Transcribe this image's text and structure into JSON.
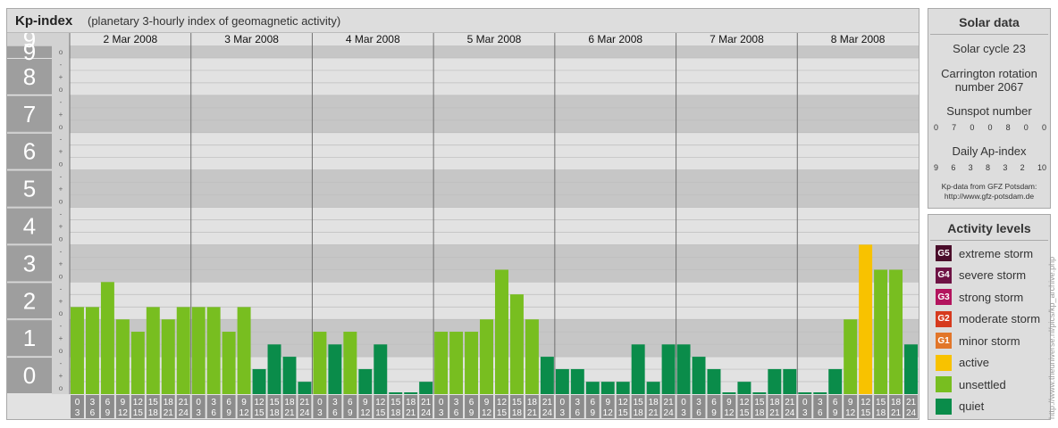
{
  "header": {
    "title": "Kp-index",
    "subtitle": "(planetary 3-hourly index of geomagnetic activity)"
  },
  "chart_data": {
    "type": "bar",
    "days": [
      "2 Mar 2008",
      "3 Mar 2008",
      "4 Mar 2008",
      "5 Mar 2008",
      "6 Mar 2008",
      "7 Mar 2008",
      "8 Mar 2008"
    ],
    "hour_ranges": [
      [
        "0",
        "3"
      ],
      [
        "3",
        "6"
      ],
      [
        "6",
        "9"
      ],
      [
        "9",
        "12"
      ],
      [
        "12",
        "15"
      ],
      [
        "15",
        "18"
      ],
      [
        "18",
        "21"
      ],
      [
        "21",
        "24"
      ]
    ],
    "y_major_ticks": [
      "0",
      "1",
      "2",
      "3",
      "4",
      "5",
      "6",
      "7",
      "8",
      "9"
    ],
    "y_minor_ticks": [
      "o",
      "+",
      "-"
    ],
    "ylim": [
      0,
      9.33
    ],
    "values": [
      [
        2.33,
        2.33,
        3.0,
        2.0,
        1.67,
        2.33,
        2.0,
        2.33
      ],
      [
        2.33,
        2.33,
        1.67,
        2.33,
        0.67,
        1.33,
        1.0,
        0.33
      ],
      [
        1.67,
        1.33,
        1.67,
        0.67,
        1.33,
        0.0,
        0.0,
        0.33
      ],
      [
        1.67,
        1.67,
        1.67,
        2.0,
        3.33,
        2.67,
        2.0,
        1.0
      ],
      [
        0.67,
        0.67,
        0.33,
        0.33,
        0.33,
        1.33,
        0.33,
        1.33
      ],
      [
        1.33,
        1.0,
        0.67,
        0.0,
        0.33,
        0.0,
        0.67,
        0.67
      ],
      [
        0.0,
        0.0,
        0.67,
        2.0,
        4.0,
        3.33,
        3.33,
        1.33
      ]
    ],
    "levels": [
      [
        "unsettled",
        "unsettled",
        "unsettled",
        "unsettled",
        "unsettled",
        "unsettled",
        "unsettled",
        "unsettled"
      ],
      [
        "unsettled",
        "unsettled",
        "unsettled",
        "unsettled",
        "quiet",
        "quiet",
        "quiet",
        "quiet"
      ],
      [
        "unsettled",
        "quiet",
        "unsettled",
        "quiet",
        "quiet",
        "quiet",
        "quiet",
        "quiet"
      ],
      [
        "unsettled",
        "unsettled",
        "unsettled",
        "unsettled",
        "unsettled",
        "unsettled",
        "unsettled",
        "quiet"
      ],
      [
        "quiet",
        "quiet",
        "quiet",
        "quiet",
        "quiet",
        "quiet",
        "quiet",
        "quiet"
      ],
      [
        "quiet",
        "quiet",
        "quiet",
        "quiet",
        "quiet",
        "quiet",
        "quiet",
        "quiet"
      ],
      [
        "quiet",
        "quiet",
        "quiet",
        "unsettled",
        "active",
        "unsettled",
        "unsettled",
        "quiet"
      ]
    ]
  },
  "solar_data": {
    "title": "Solar data",
    "cycle": "Solar cycle 23",
    "carrington_line1": "Carrington rotation",
    "carrington_line2": "number 2067",
    "sunspot_label": "Sunspot number",
    "sunspot_values": [
      "0",
      "7",
      "0",
      "0",
      "8",
      "0",
      "0"
    ],
    "ap_label": "Daily Ap-index",
    "ap_values": [
      "9",
      "6",
      "3",
      "8",
      "3",
      "2",
      "10"
    ],
    "source_line1": "Kp-data from GFZ Potsdam:",
    "source_line2": "http://www.gfz-potsdam.de"
  },
  "activity_levels": {
    "title": "Activity levels",
    "items": [
      {
        "code": "G5",
        "label": "extreme storm",
        "color": "#4a0d2a"
      },
      {
        "code": "G4",
        "label": "severe storm",
        "color": "#6e1244"
      },
      {
        "code": "G3",
        "label": "strong storm",
        "color": "#b3145e"
      },
      {
        "code": "G2",
        "label": "moderate storm",
        "color": "#d63a1e"
      },
      {
        "code": "G1",
        "label": "minor storm",
        "color": "#e2762a"
      },
      {
        "code": "",
        "label": "active",
        "color": "#f8c200"
      },
      {
        "code": "",
        "label": "unsettled",
        "color": "#78be20"
      },
      {
        "code": "",
        "label": "quiet",
        "color": "#0a8c4a"
      }
    ]
  },
  "colors": {
    "quiet": "#0a8c4a",
    "unsettled": "#78be20",
    "active": "#f8c200",
    "band_dark": "#c6c6c6",
    "band_light": "#e2e2e2",
    "axis_label_bg": "#9e9e9e",
    "hour_box_bg": "#8c8c8c"
  },
  "watermark": "http://www.theuniverse.nl/pics/kp_archive.php"
}
